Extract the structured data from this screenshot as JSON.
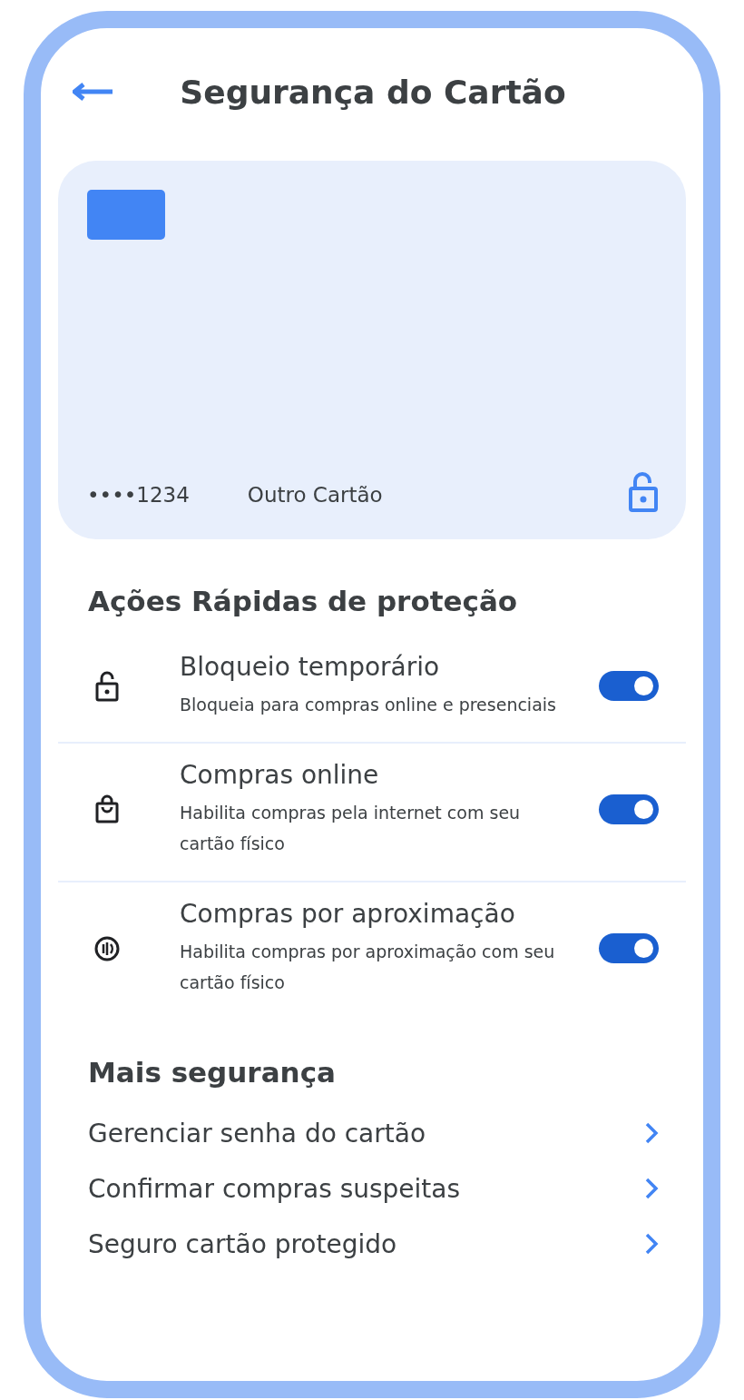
{
  "header": {
    "title": "Segurança do Cartão"
  },
  "card": {
    "number": "••••1234",
    "name": "Outro Cartão"
  },
  "quick_actions": {
    "title": "Ações Rápidas de proteção",
    "items": [
      {
        "kind": "lock",
        "title": "Bloqueio temporário",
        "description": "Bloqueia para compras online e presenciais",
        "on": true
      },
      {
        "kind": "bag",
        "title": "Compras online",
        "description": "Habilita compras pela internet com seu cartão físico",
        "on": true
      },
      {
        "kind": "contactless",
        "title": "Compras por aproximação",
        "description": "Habilita compras por aproximação com seu cartão físico",
        "on": true
      }
    ]
  },
  "more_security": {
    "title": "Mais segurança",
    "links": [
      "Gerenciar senha do cartão",
      "Confirmar compras suspeitas",
      "Seguro cartão protegido"
    ]
  }
}
